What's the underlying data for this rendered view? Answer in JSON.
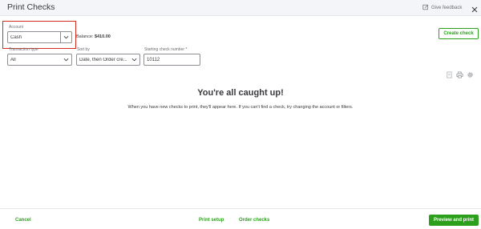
{
  "header": {
    "title": "Print Checks",
    "feedback_label": "Give feedback"
  },
  "account": {
    "label": "Account",
    "value": "Cash",
    "balance_label": "Balance:",
    "balance_value": "$410.00"
  },
  "create_check_label": "Create check",
  "filters": {
    "transaction_type": {
      "label": "Transaction type",
      "value": "All"
    },
    "sort_by": {
      "label": "Sort by",
      "value": "Date, then Order cre..."
    },
    "starting_check": {
      "label": "Starting check number *",
      "value": "10112"
    }
  },
  "empty_state": {
    "title": "You're all caught up!",
    "description": "When you have new checks to print, they'll appear here. If you can't find a check, try changing the account or filters."
  },
  "footer": {
    "cancel_label": "Cancel",
    "print_setup_label": "Print setup",
    "order_checks_label": "Order checks",
    "preview_print_label": "Preview and print"
  },
  "colors": {
    "brand_green": "#2ca01c",
    "highlight_red": "#d52b1e",
    "text": "#393a3d"
  },
  "icons": [
    "feedback-icon",
    "close-icon",
    "chevron-down-icon",
    "copy-icon",
    "print-icon",
    "settings-gear-icon"
  ]
}
